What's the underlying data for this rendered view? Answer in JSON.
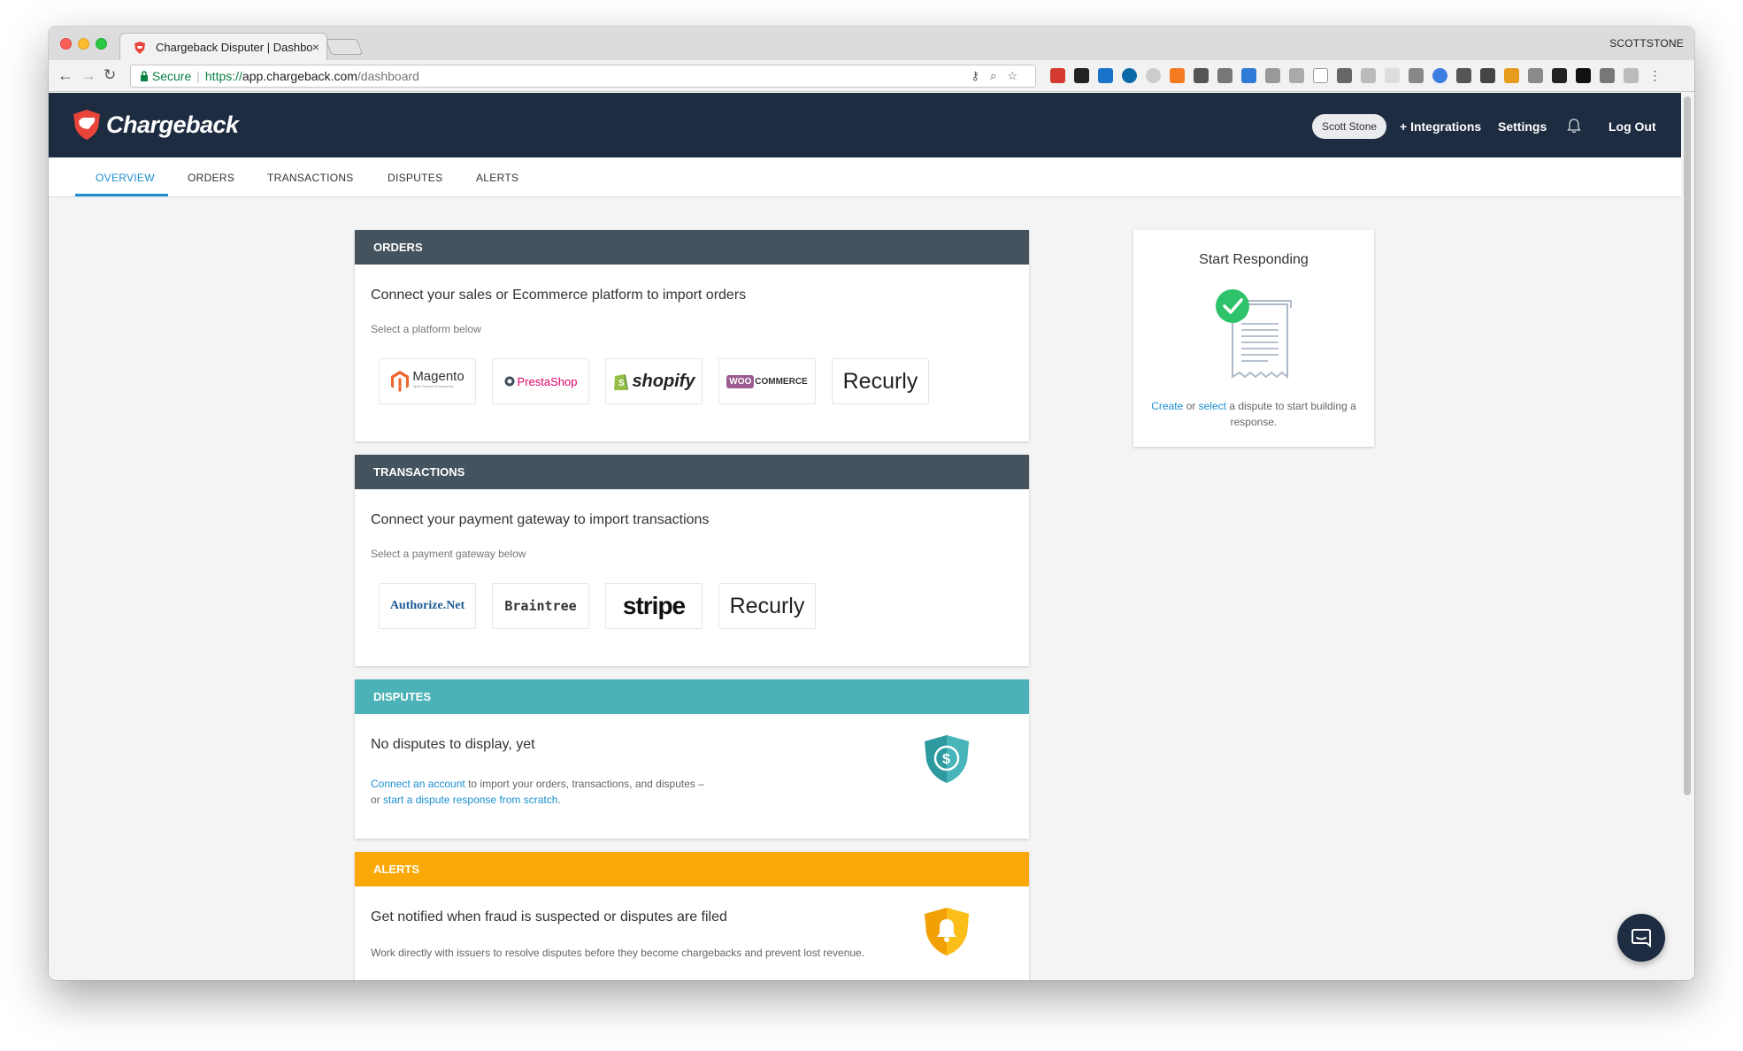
{
  "browser": {
    "tab_title": "Chargeback Disputer | Dashbo",
    "tab_close": "×",
    "profile_name": "SCOTTSTONE",
    "secure_label": "Secure",
    "url_scheme": "https://",
    "url_host": "app.chargeback.com",
    "url_path": "/dashboard"
  },
  "header": {
    "logo_text": "Chargeback",
    "user_name": "Scott Stone",
    "integrations": "+ Integrations",
    "settings": "Settings",
    "logout": "Log Out"
  },
  "subnav": {
    "items": [
      "OVERVIEW",
      "ORDERS",
      "TRANSACTIONS",
      "DISPUTES",
      "ALERTS"
    ],
    "active": "OVERVIEW"
  },
  "orders": {
    "header": "ORDERS",
    "title": "Connect your sales or Ecommerce platform to import orders",
    "subtitle": "Select a platform below",
    "platforms": [
      "Magento",
      "PrestaShop",
      "shopify",
      "COMMERCE",
      "Recurly"
    ],
    "magento_sub": "Open Source eCommerce",
    "woo_prefix": "WOO"
  },
  "transactions": {
    "header": "TRANSACTIONS",
    "title": "Connect your payment gateway to import transactions",
    "subtitle": "Select a payment gateway below",
    "gateways": [
      "Authorize.Net",
      "Braintree",
      "stripe",
      "Recurly"
    ]
  },
  "disputes": {
    "header": "DISPUTES",
    "title": "No disputes to display, yet",
    "link1": "Connect an account",
    "text1": " to import your orders, transactions, and disputes –",
    "text2": "or ",
    "link2": "start a dispute response from scratch",
    "text3": "."
  },
  "alerts": {
    "header": "ALERTS",
    "title": "Get notified when fraud is suspected or disputes are filed",
    "text": "Work directly with issuers to resolve disputes before they become chargebacks and prevent lost revenue."
  },
  "start_responding": {
    "title": "Start Responding",
    "link_create": "Create",
    "or": " or ",
    "link_select": "select",
    "text": " a dispute to start building a response."
  },
  "colors": {
    "header_bg": "#1d2c40",
    "orders_head": "#44535e",
    "disputes_head": "#4cb2b7",
    "alerts_head": "#f9a805",
    "link": "#1b8fd0",
    "brand_red": "#e8443a"
  },
  "icons": {
    "brand": "shield-logo-icon",
    "bell": "bell-icon",
    "dispute": "dispute-shield-icon",
    "alert": "alert-shield-icon",
    "receipt": "receipt-check-icon",
    "chat": "chat-bubble-icon"
  }
}
